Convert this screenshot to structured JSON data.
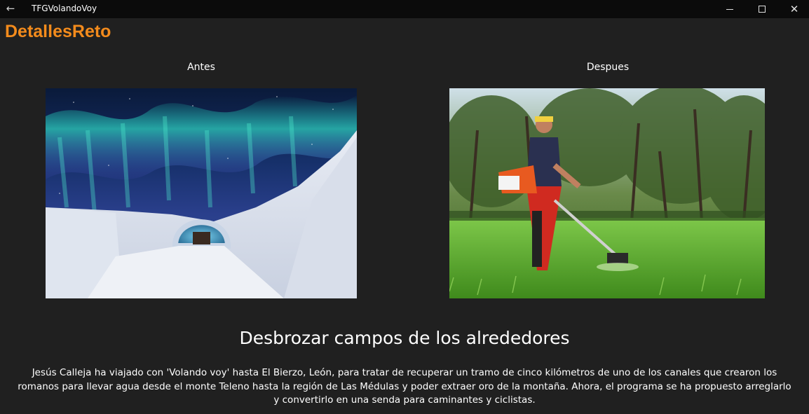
{
  "window": {
    "title": "TFGVolandoVoy",
    "back_icon": "arrow-left-icon",
    "close_symbol": "✕"
  },
  "page": {
    "title": "DetallesReto"
  },
  "images": {
    "before_label": "Antes",
    "after_label": "Despues"
  },
  "reto": {
    "title": "Desbrozar campos de los alrededores",
    "description": "Jesús Calleja ha viajado con 'Volando voy' hasta El Bierzo, León, para tratar de recuperar un tramo de cinco kilómetros de uno de los canales que crearon los romanos para llevar agua desde el monte Teleno hasta la región de Las Médulas y poder extraer oro de la montaña. Ahora, el programa se ha propuesto arreglarlo y convertirlo en una senda para caminantes y ciclistas."
  },
  "colors": {
    "accent": "#f38b1c",
    "background": "#202020",
    "titlebar": "#0b0b0b"
  }
}
